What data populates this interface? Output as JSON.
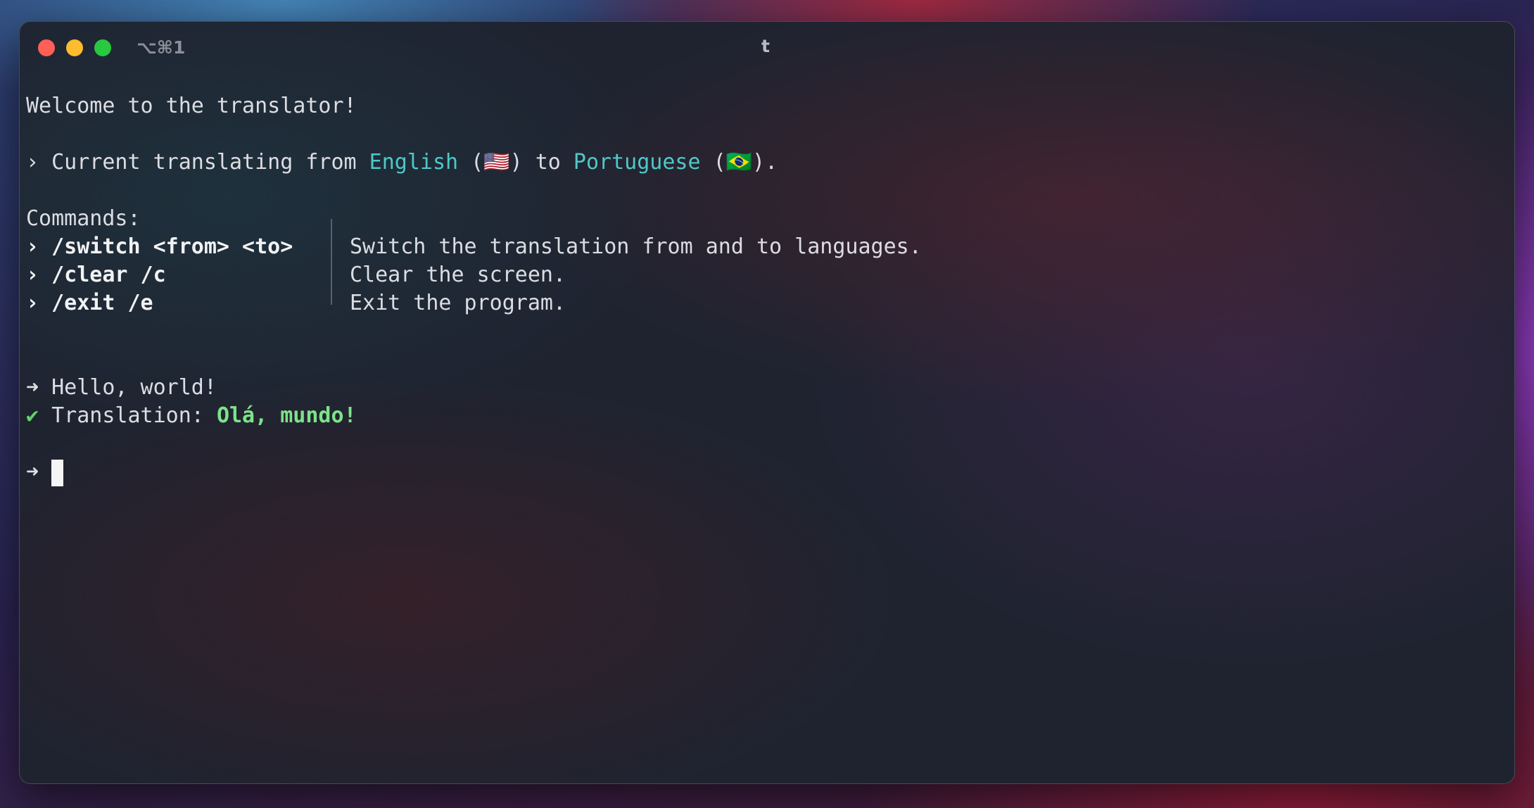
{
  "window": {
    "shortcut": "⌥⌘1",
    "title": "t"
  },
  "terminal": {
    "welcome": "Welcome to the translator!",
    "status": {
      "prompt": "›",
      "prefix": "Current translating from",
      "from_lang": "English",
      "from_flag": "(🇺🇸)",
      "middle": "to",
      "to_lang": "Portuguese",
      "to_flag": "(🇧🇷)",
      "suffix": "."
    },
    "commands_label": "Commands:",
    "commands": [
      {
        "prompt": "›",
        "cmd": "/switch <from> <to>",
        "desc": "Switch the translation from and to languages."
      },
      {
        "prompt": "›",
        "cmd": "/clear /c",
        "desc": "Clear the screen."
      },
      {
        "prompt": "›",
        "cmd": "/exit /e",
        "desc": "Exit the program."
      }
    ],
    "input_arrow": "➜",
    "input_text": "Hello, world!",
    "result_mark": "✔",
    "result_label": "Translation:",
    "result_text": "Olá, mundo!",
    "prompt_arrow": "➜"
  },
  "colors": {
    "accent": "#4fc8c8",
    "success": "#63d46a",
    "text": "#dcdde2"
  }
}
